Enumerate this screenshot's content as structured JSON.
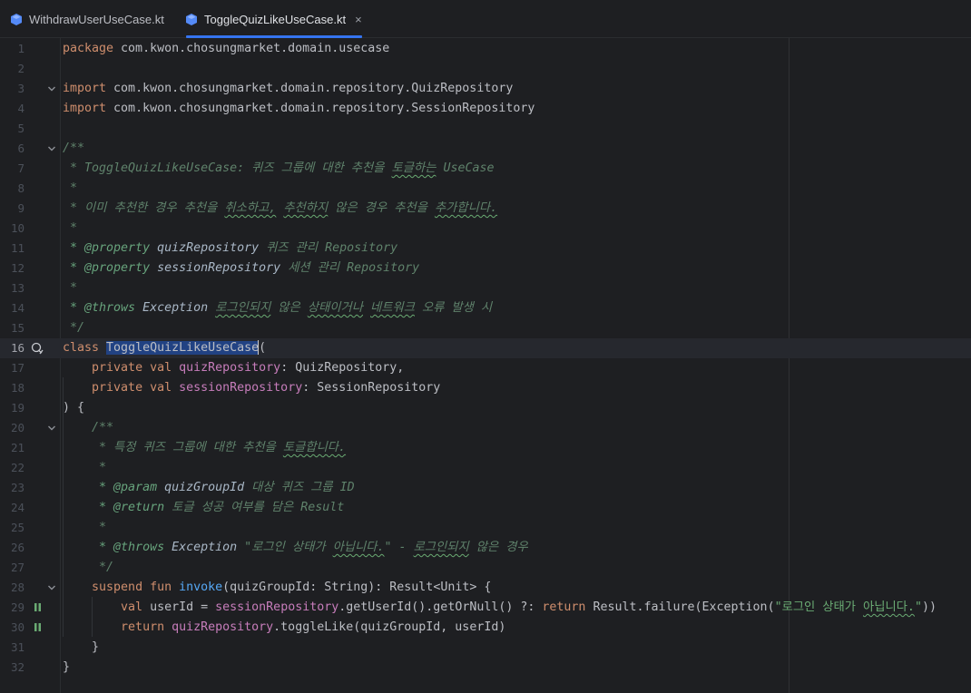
{
  "tabs": [
    {
      "label": "WithdrawUserUseCase.kt",
      "active": false
    },
    {
      "label": "ToggleQuizLikeUseCase.kt",
      "active": true,
      "close": "×"
    }
  ],
  "lines": [
    {
      "n": "1",
      "segs": [
        [
          "kw",
          "package "
        ],
        [
          "",
          "com.kwon.chosungmarket.domain.usecase"
        ]
      ]
    },
    {
      "n": "2",
      "segs": []
    },
    {
      "n": "3",
      "fold": true,
      "segs": [
        [
          "kw",
          "import "
        ],
        [
          "",
          "com.kwon.chosungmarket.domain.repository.QuizRepository"
        ]
      ]
    },
    {
      "n": "4",
      "segs": [
        [
          "kw",
          "import "
        ],
        [
          "",
          "com.kwon.chosungmarket.domain.repository.SessionRepository"
        ]
      ]
    },
    {
      "n": "5",
      "segs": []
    },
    {
      "n": "6",
      "fold": true,
      "segs": [
        [
          "doc",
          "/**"
        ]
      ]
    },
    {
      "n": "7",
      "segs": [
        [
          "doc",
          " * ToggleQuizLikeUseCase: 퀴즈 그룹에 대한 추천을 "
        ],
        [
          "doc squig",
          "토글하는"
        ],
        [
          "doc",
          " UseCase"
        ]
      ]
    },
    {
      "n": "8",
      "segs": [
        [
          "doc",
          " *"
        ]
      ]
    },
    {
      "n": "9",
      "segs": [
        [
          "doc",
          " * 이미 추천한 경우 추천을 "
        ],
        [
          "doc squig",
          "취소하고,"
        ],
        [
          "doc",
          " "
        ],
        [
          "doc squig",
          "추천하지"
        ],
        [
          "doc",
          " 않은 경우 추천을 "
        ],
        [
          "doc squig",
          "추가합니다."
        ]
      ]
    },
    {
      "n": "10",
      "segs": [
        [
          "doc",
          " *"
        ]
      ]
    },
    {
      "n": "11",
      "segs": [
        [
          "doc",
          " "
        ],
        [
          "tag",
          "* @property"
        ],
        [
          "tagv",
          " quizRepository"
        ],
        [
          "doc",
          " 퀴즈 관리 Repository"
        ]
      ]
    },
    {
      "n": "12",
      "segs": [
        [
          "doc",
          " "
        ],
        [
          "tag",
          "* @property"
        ],
        [
          "tagv",
          " sessionRepository"
        ],
        [
          "doc",
          " 세션 관리 Repository"
        ]
      ]
    },
    {
      "n": "13",
      "segs": [
        [
          "doc",
          " *"
        ]
      ]
    },
    {
      "n": "14",
      "segs": [
        [
          "doc",
          " "
        ],
        [
          "tag",
          "* @throws"
        ],
        [
          "tagv",
          " Exception"
        ],
        [
          "doc",
          " "
        ],
        [
          "doc squig",
          "로그인되지"
        ],
        [
          "doc",
          " 않은 "
        ],
        [
          "doc squig",
          "상태이거나"
        ],
        [
          "doc",
          " "
        ],
        [
          "doc squig",
          "네트워크"
        ],
        [
          "doc",
          " 오류 발생 시"
        ]
      ]
    },
    {
      "n": "15",
      "segs": [
        [
          "doc",
          " */"
        ]
      ]
    },
    {
      "n": "16",
      "current": true,
      "icon": true,
      "segs": [
        [
          "kw",
          "class "
        ],
        [
          "sel",
          "ToggleQuizLikeUseCase"
        ],
        [
          "",
          "("
        ]
      ]
    },
    {
      "n": "17",
      "segs": [
        [
          "",
          "    "
        ],
        [
          "kw",
          "private val "
        ],
        [
          "prop",
          "quizRepository"
        ],
        [
          "",
          ": QuizRepository,"
        ]
      ]
    },
    {
      "n": "18",
      "segs": [
        [
          "",
          "    "
        ],
        [
          "kw",
          "private val "
        ],
        [
          "prop",
          "sessionRepository"
        ],
        [
          "",
          ": SessionRepository"
        ]
      ]
    },
    {
      "n": "19",
      "segs": [
        [
          "",
          ") {"
        ]
      ]
    },
    {
      "n": "20",
      "fold": true,
      "segs": [
        [
          "",
          "    "
        ],
        [
          "doc",
          "/**"
        ]
      ]
    },
    {
      "n": "21",
      "segs": [
        [
          "doc",
          "     * 특정 퀴즈 그룹에 대한 추천을 "
        ],
        [
          "doc squig",
          "토글합니다."
        ]
      ]
    },
    {
      "n": "22",
      "segs": [
        [
          "doc",
          "     *"
        ]
      ]
    },
    {
      "n": "23",
      "segs": [
        [
          "doc",
          "     "
        ],
        [
          "tag",
          "* @param"
        ],
        [
          "tagv",
          " quizGroupId"
        ],
        [
          "doc",
          " 대상 퀴즈 그룹 ID"
        ]
      ]
    },
    {
      "n": "24",
      "segs": [
        [
          "doc",
          "     "
        ],
        [
          "tag",
          "* @return"
        ],
        [
          "doc",
          " 토글 성공 여부를 담은 Result"
        ]
      ]
    },
    {
      "n": "25",
      "segs": [
        [
          "doc",
          "     *"
        ]
      ]
    },
    {
      "n": "26",
      "segs": [
        [
          "doc",
          "     "
        ],
        [
          "tag",
          "* @throws"
        ],
        [
          "tagv",
          " Exception"
        ],
        [
          "doc",
          " \"로그인 상태가 "
        ],
        [
          "doc squig",
          "아닙니다."
        ],
        [
          "doc",
          "\" - "
        ],
        [
          "doc squig",
          "로그인되지"
        ],
        [
          "doc",
          " 않은 경우"
        ]
      ]
    },
    {
      "n": "27",
      "segs": [
        [
          "doc",
          "     */"
        ]
      ]
    },
    {
      "n": "28",
      "fold": true,
      "segs": [
        [
          "",
          "    "
        ],
        [
          "kw",
          "suspend fun "
        ],
        [
          "fn",
          "invoke"
        ],
        [
          "",
          "(quizGroupId: String): Result<Unit> {"
        ]
      ]
    },
    {
      "n": "29",
      "mark": true,
      "segs": [
        [
          "",
          "        "
        ],
        [
          "kw",
          "val "
        ],
        [
          "",
          "userId = "
        ],
        [
          "prop",
          "sessionRepository"
        ],
        [
          "",
          ".getUserId().getOrNull() ?: "
        ],
        [
          "kw",
          "return "
        ],
        [
          "",
          "Result.failure(Exception("
        ],
        [
          "str",
          "\"로그인 상태가 "
        ],
        [
          "str squig",
          "아닙니다."
        ],
        [
          "str",
          "\""
        ],
        [
          "",
          "))"
        ]
      ]
    },
    {
      "n": "30",
      "mark": true,
      "segs": [
        [
          "",
          "        "
        ],
        [
          "kw",
          "return "
        ],
        [
          "prop",
          "quizRepository"
        ],
        [
          "",
          ".toggleLike(quizGroupId, userId)"
        ]
      ]
    },
    {
      "n": "31",
      "segs": [
        [
          "",
          "    }"
        ]
      ]
    },
    {
      "n": "32",
      "segs": [
        [
          "",
          "}"
        ]
      ]
    }
  ],
  "icons": {
    "file": "kotlin-file-icon",
    "gutter_class": "class-implementations-icon",
    "run": "suspend-call-icon",
    "fold": "fold-arrow-icon"
  },
  "colors": {
    "background": "#1e1f22",
    "keyword": "#cf8e6d",
    "string": "#6aab73",
    "doc": "#5f826b",
    "property": "#c77dbb",
    "function": "#56a8f5",
    "selection": "#214283",
    "tab_accent": "#3574f0"
  }
}
